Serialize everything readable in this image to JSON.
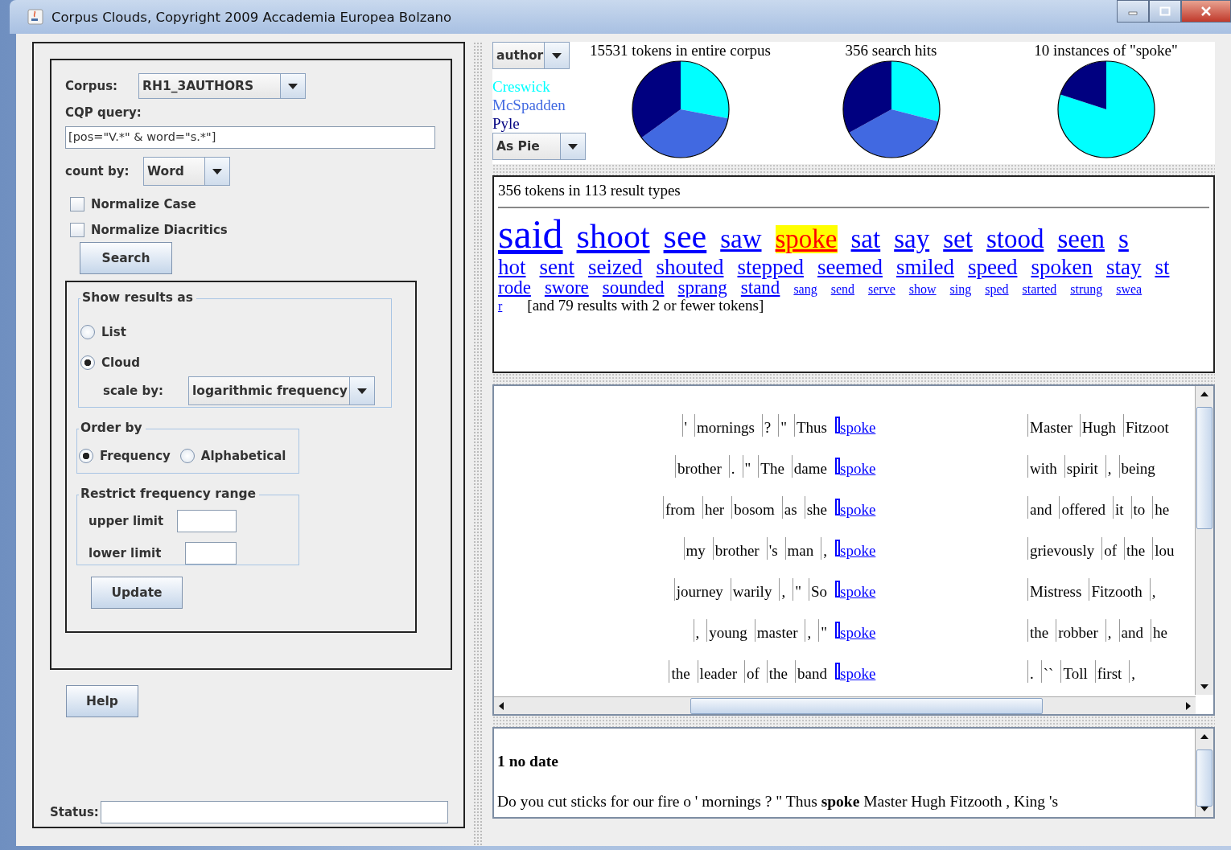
{
  "window": {
    "title": "Corpus Clouds, Copyright 2009 Accademia Europea Bolzano"
  },
  "query_panel": {
    "corpus_label": "Corpus:",
    "corpus": "RH1_3AUTHORS",
    "query_label": "CQP query:",
    "query": "[pos=\"V.*\" & word=\"s.*\"]",
    "count_label": "count by:",
    "count_by": "Word",
    "checkboxes": [
      {
        "label": "Normalize Case",
        "checked": false
      },
      {
        "label": "Normalize Diacritics",
        "checked": false
      }
    ],
    "search_button": "Search"
  },
  "display_panel": {
    "show_group": {
      "title": "Show results as",
      "options": [
        {
          "label": "List",
          "selected": false
        },
        {
          "label": "Cloud",
          "selected": true
        }
      ],
      "scale_label": "scale by:",
      "scale_by": "logarithmic frequency"
    },
    "order_group": {
      "title": "Order by",
      "options": [
        {
          "label": "Frequency",
          "selected": true
        },
        {
          "label": "Alphabetical",
          "selected": false
        }
      ]
    },
    "range_group": {
      "title": "Restrict frequency range",
      "upper_label": "upper limit",
      "lower_label": "lower limit"
    },
    "update_button": "Update"
  },
  "help_button": "Help",
  "status_label": "Status:",
  "distribution": {
    "facet": "author",
    "legend": [
      {
        "name": "Creswick",
        "color": "#00ffff"
      },
      {
        "name": "McSpadden",
        "color": "#4169e1"
      },
      {
        "name": "Pyle",
        "color": "#000080"
      }
    ],
    "mode": "As Pie",
    "pies": [
      {
        "title": "15531 tokens in entire corpus"
      },
      {
        "title": "356 search hits"
      },
      {
        "title": "10 instances of \"spoke\""
      }
    ]
  },
  "cloud": {
    "summary": "356 tokens in 113 result types",
    "lines": [
      [
        {
          "word": "said",
          "kind": "huge",
          "selected": false
        },
        {
          "word": "shoot",
          "kind": "large",
          "selected": false
        },
        {
          "word": "see",
          "kind": "large",
          "selected": false
        },
        {
          "word": "saw",
          "kind": "big",
          "selected": false
        },
        {
          "word": "spoke",
          "kind": "big",
          "selected": true
        },
        {
          "word": "sat",
          "kind": "big",
          "selected": false
        },
        {
          "word": "say",
          "kind": "big",
          "selected": false
        },
        {
          "word": "set",
          "kind": "big",
          "selected": false
        },
        {
          "word": "stood",
          "kind": "big",
          "selected": false
        },
        {
          "word": "seen",
          "kind": "big",
          "selected": false
        },
        {
          "word": "s",
          "kind": "big",
          "selected": false
        }
      ],
      [
        {
          "word": "hot",
          "kind": "medium",
          "selected": false
        },
        {
          "word": "sent",
          "kind": "medium",
          "selected": false
        },
        {
          "word": "seized",
          "kind": "medium",
          "selected": false
        },
        {
          "word": "shouted",
          "kind": "medium",
          "selected": false
        },
        {
          "word": "stepped",
          "kind": "medium",
          "selected": false
        },
        {
          "word": "seemed",
          "kind": "medium",
          "selected": false
        },
        {
          "word": "smiled",
          "kind": "medium",
          "selected": false
        },
        {
          "word": "speed",
          "kind": "medium",
          "selected": false
        },
        {
          "word": "spoken",
          "kind": "medium",
          "selected": false
        },
        {
          "word": "stay",
          "kind": "medium",
          "selected": false
        },
        {
          "word": "st",
          "kind": "medium",
          "selected": false
        }
      ],
      [
        {
          "word": "rode",
          "kind": "small",
          "selected": false
        },
        {
          "word": "swore",
          "kind": "small",
          "selected": false
        },
        {
          "word": "sounded",
          "kind": "small",
          "selected": false
        },
        {
          "word": "sprang",
          "kind": "small",
          "selected": false
        },
        {
          "word": "stand",
          "kind": "small",
          "selected": false
        },
        {
          "word": "sang",
          "kind": "tiny",
          "selected": false
        },
        {
          "word": "send",
          "kind": "tiny",
          "selected": false
        },
        {
          "word": "serve",
          "kind": "tiny",
          "selected": false
        },
        {
          "word": "show",
          "kind": "tiny",
          "selected": false
        },
        {
          "word": "sing",
          "kind": "tiny",
          "selected": false
        },
        {
          "word": "sped",
          "kind": "tiny",
          "selected": false
        },
        {
          "word": "started",
          "kind": "tiny",
          "selected": false
        },
        {
          "word": "strung",
          "kind": "tiny",
          "selected": false
        },
        {
          "word": "swea",
          "kind": "tiny",
          "selected": false
        }
      ],
      [
        {
          "word": "r",
          "kind": "tiny",
          "selected": false
        }
      ]
    ],
    "note": "[and 79 results with 2 or fewer tokens]"
  },
  "concordance": [
    {
      "left": [
        "'",
        "mornings",
        "?",
        "\"",
        "Thus"
      ],
      "keyword": "spoke",
      "right": [
        "Master",
        "Hugh",
        "Fitzoot"
      ]
    },
    {
      "left": [
        "brother",
        ".",
        "\"",
        "The",
        "dame"
      ],
      "keyword": "spoke",
      "right": [
        "with",
        "spirit",
        ",",
        "being"
      ]
    },
    {
      "left": [
        "from",
        "her",
        "bosom",
        "as",
        "she"
      ],
      "keyword": "spoke",
      "right": [
        "and",
        "offered",
        "it",
        "to",
        "he"
      ]
    },
    {
      "left": [
        "my",
        "brother",
        "'s",
        "man",
        ","
      ],
      "keyword": "spoke",
      "right": [
        "grievously",
        "of",
        "the",
        "lou"
      ]
    },
    {
      "left": [
        "journey",
        "warily",
        ",",
        "\"",
        "So"
      ],
      "keyword": "spoke",
      "right": [
        "Mistress",
        "Fitzooth",
        ","
      ]
    },
    {
      "left": [
        ",",
        "young",
        "master",
        ",",
        "\""
      ],
      "keyword": "spoke",
      "right": [
        "the",
        "robber",
        ",",
        "and",
        "he"
      ]
    },
    {
      "left": [
        "the",
        "leader",
        "of",
        "the",
        "band"
      ],
      "keyword": "spoke",
      "right": [
        ".",
        "``",
        "Toll",
        "first",
        ","
      ]
    }
  ],
  "detail": {
    "heading": "1 no date",
    "text": "Do you cut sticks for our fire o ' mornings ? \" Thus **spoke** Master Hugh Fitzooth , King 's"
  }
}
